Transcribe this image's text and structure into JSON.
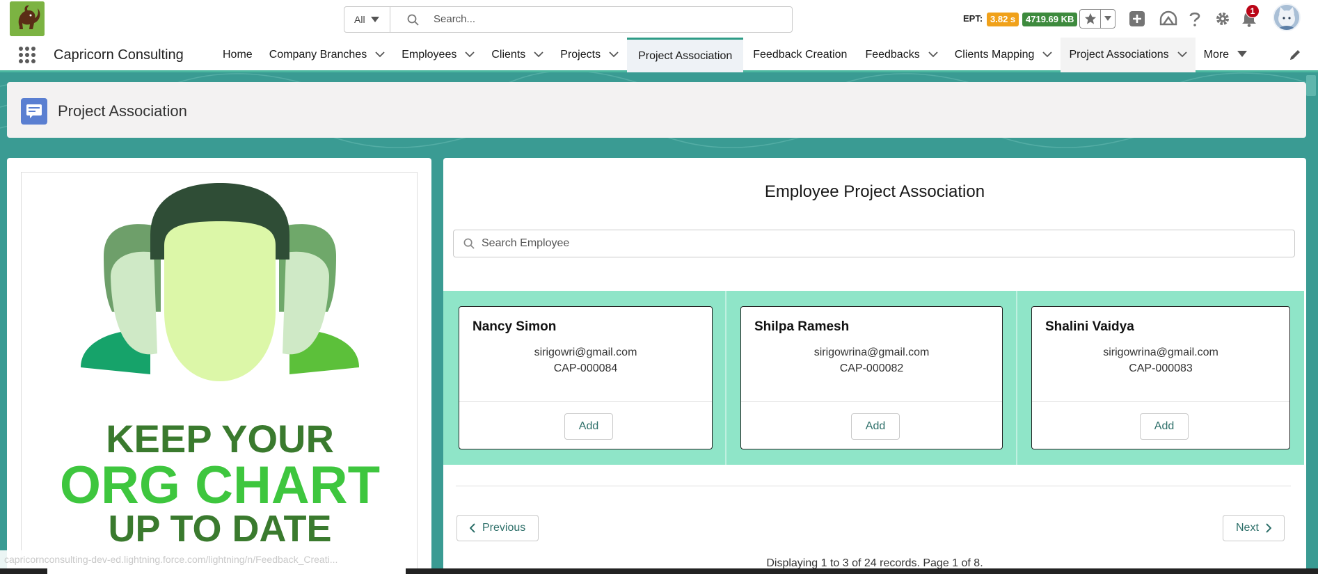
{
  "header": {
    "search_scope": "All",
    "search_placeholder": "Search...",
    "ept_label": "EPT:",
    "ept_time": "3.82 s",
    "ept_memory": "4719.69 KB",
    "notification_count": "1"
  },
  "nav": {
    "app_name": "Capricorn Consulting",
    "items": [
      {
        "label": "Home",
        "dropdown": false
      },
      {
        "label": "Company Branches",
        "dropdown": true
      },
      {
        "label": "Employees",
        "dropdown": true
      },
      {
        "label": "Clients",
        "dropdown": true
      },
      {
        "label": "Projects",
        "dropdown": true
      },
      {
        "label": "Project Association",
        "dropdown": false,
        "active": true
      },
      {
        "label": "Feedback Creation",
        "dropdown": false
      },
      {
        "label": "Feedbacks",
        "dropdown": true
      },
      {
        "label": "Clients Mapping",
        "dropdown": true
      },
      {
        "label": "Project Associations",
        "dropdown": true
      },
      {
        "label": "More",
        "dropdown": true
      }
    ]
  },
  "page_header": {
    "title": "Project Association"
  },
  "left_panel": {
    "poster_line1": "KEEP YOUR",
    "poster_line2": "ORG CHART",
    "poster_line3": "UP TO DATE"
  },
  "main": {
    "title": "Employee Project Association",
    "search_placeholder": "Search Employee",
    "employees": [
      {
        "name": "Nancy Simon",
        "email": "sirigowri@gmail.com",
        "id": "CAP-000084",
        "action": "Add"
      },
      {
        "name": "Shilpa Ramesh",
        "email": "sirigowrina@gmail.com",
        "id": "CAP-000082",
        "action": "Add"
      },
      {
        "name": "Shalini Vaidya",
        "email": "sirigowrina@gmail.com",
        "id": "CAP-000083",
        "action": "Add"
      }
    ],
    "pagination": {
      "previous": "Previous",
      "next": "Next",
      "info": "Displaying 1 to 3 of 24 records. Page 1 of 8."
    }
  },
  "status_url": "capricornconsulting-dev-ed.lightning.force.com/lightning/n/Feedback_Creati...",
  "colors": {
    "brand_teal": "#3a9b93",
    "card_band": "#8fe5c8",
    "ept_time_bg": "#f0a11a",
    "ept_memory_bg": "#3d8a3d",
    "page_icon": "#5a7fd1"
  }
}
